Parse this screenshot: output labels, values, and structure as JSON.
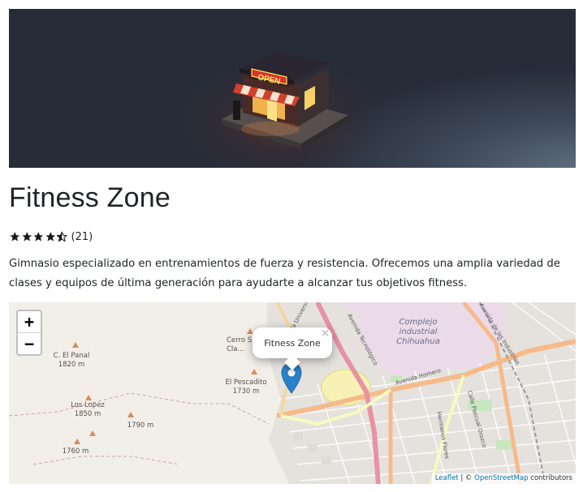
{
  "place": {
    "name": "Fitness Zone",
    "rating_value": 4.5,
    "rating_max": 5,
    "rating_count": "(21)",
    "description": "Gimnasio especializado en entrenamientos de fuerza y resistencia. Ofrecemos una amplia variedad de clases y equipos de última generación para ayudarte a alcanzar tus objetivos fitness."
  },
  "hero": {
    "sign_text": "OPEN"
  },
  "map": {
    "zoom_in_label": "+",
    "zoom_out_label": "−",
    "popup_text": "Fitness Zone",
    "popup_close": "×",
    "peaks": [
      {
        "name": "C. El Panal",
        "elevation": "1820 m"
      },
      {
        "name": "Los Lopez",
        "elevation": "1850 m"
      },
      {
        "name": "El Pescadito",
        "elevation": "1730 m"
      },
      {
        "name": "Cerro S...",
        "elevation": "Cla..."
      }
    ],
    "spot_heights": [
      "1790 m",
      "1760 m"
    ],
    "area_label": "Complejo industrial Chihuahua",
    "streets": [
      "Avenida Tecnológico",
      "Avenida Homero",
      "Calle Pascual Orozco",
      "Hermanos Flores",
      "Avenida Universidad",
      "Avenida de las Industrias"
    ],
    "attribution_leaflet": "Leaflet",
    "attribution_sep": " | © ",
    "attribution_osm": "OpenStreetMap",
    "attribution_suffix": " contributors"
  },
  "colors": {
    "star": "#1a1a1a",
    "marker": "#2a81cb",
    "link": "#0078a8"
  }
}
